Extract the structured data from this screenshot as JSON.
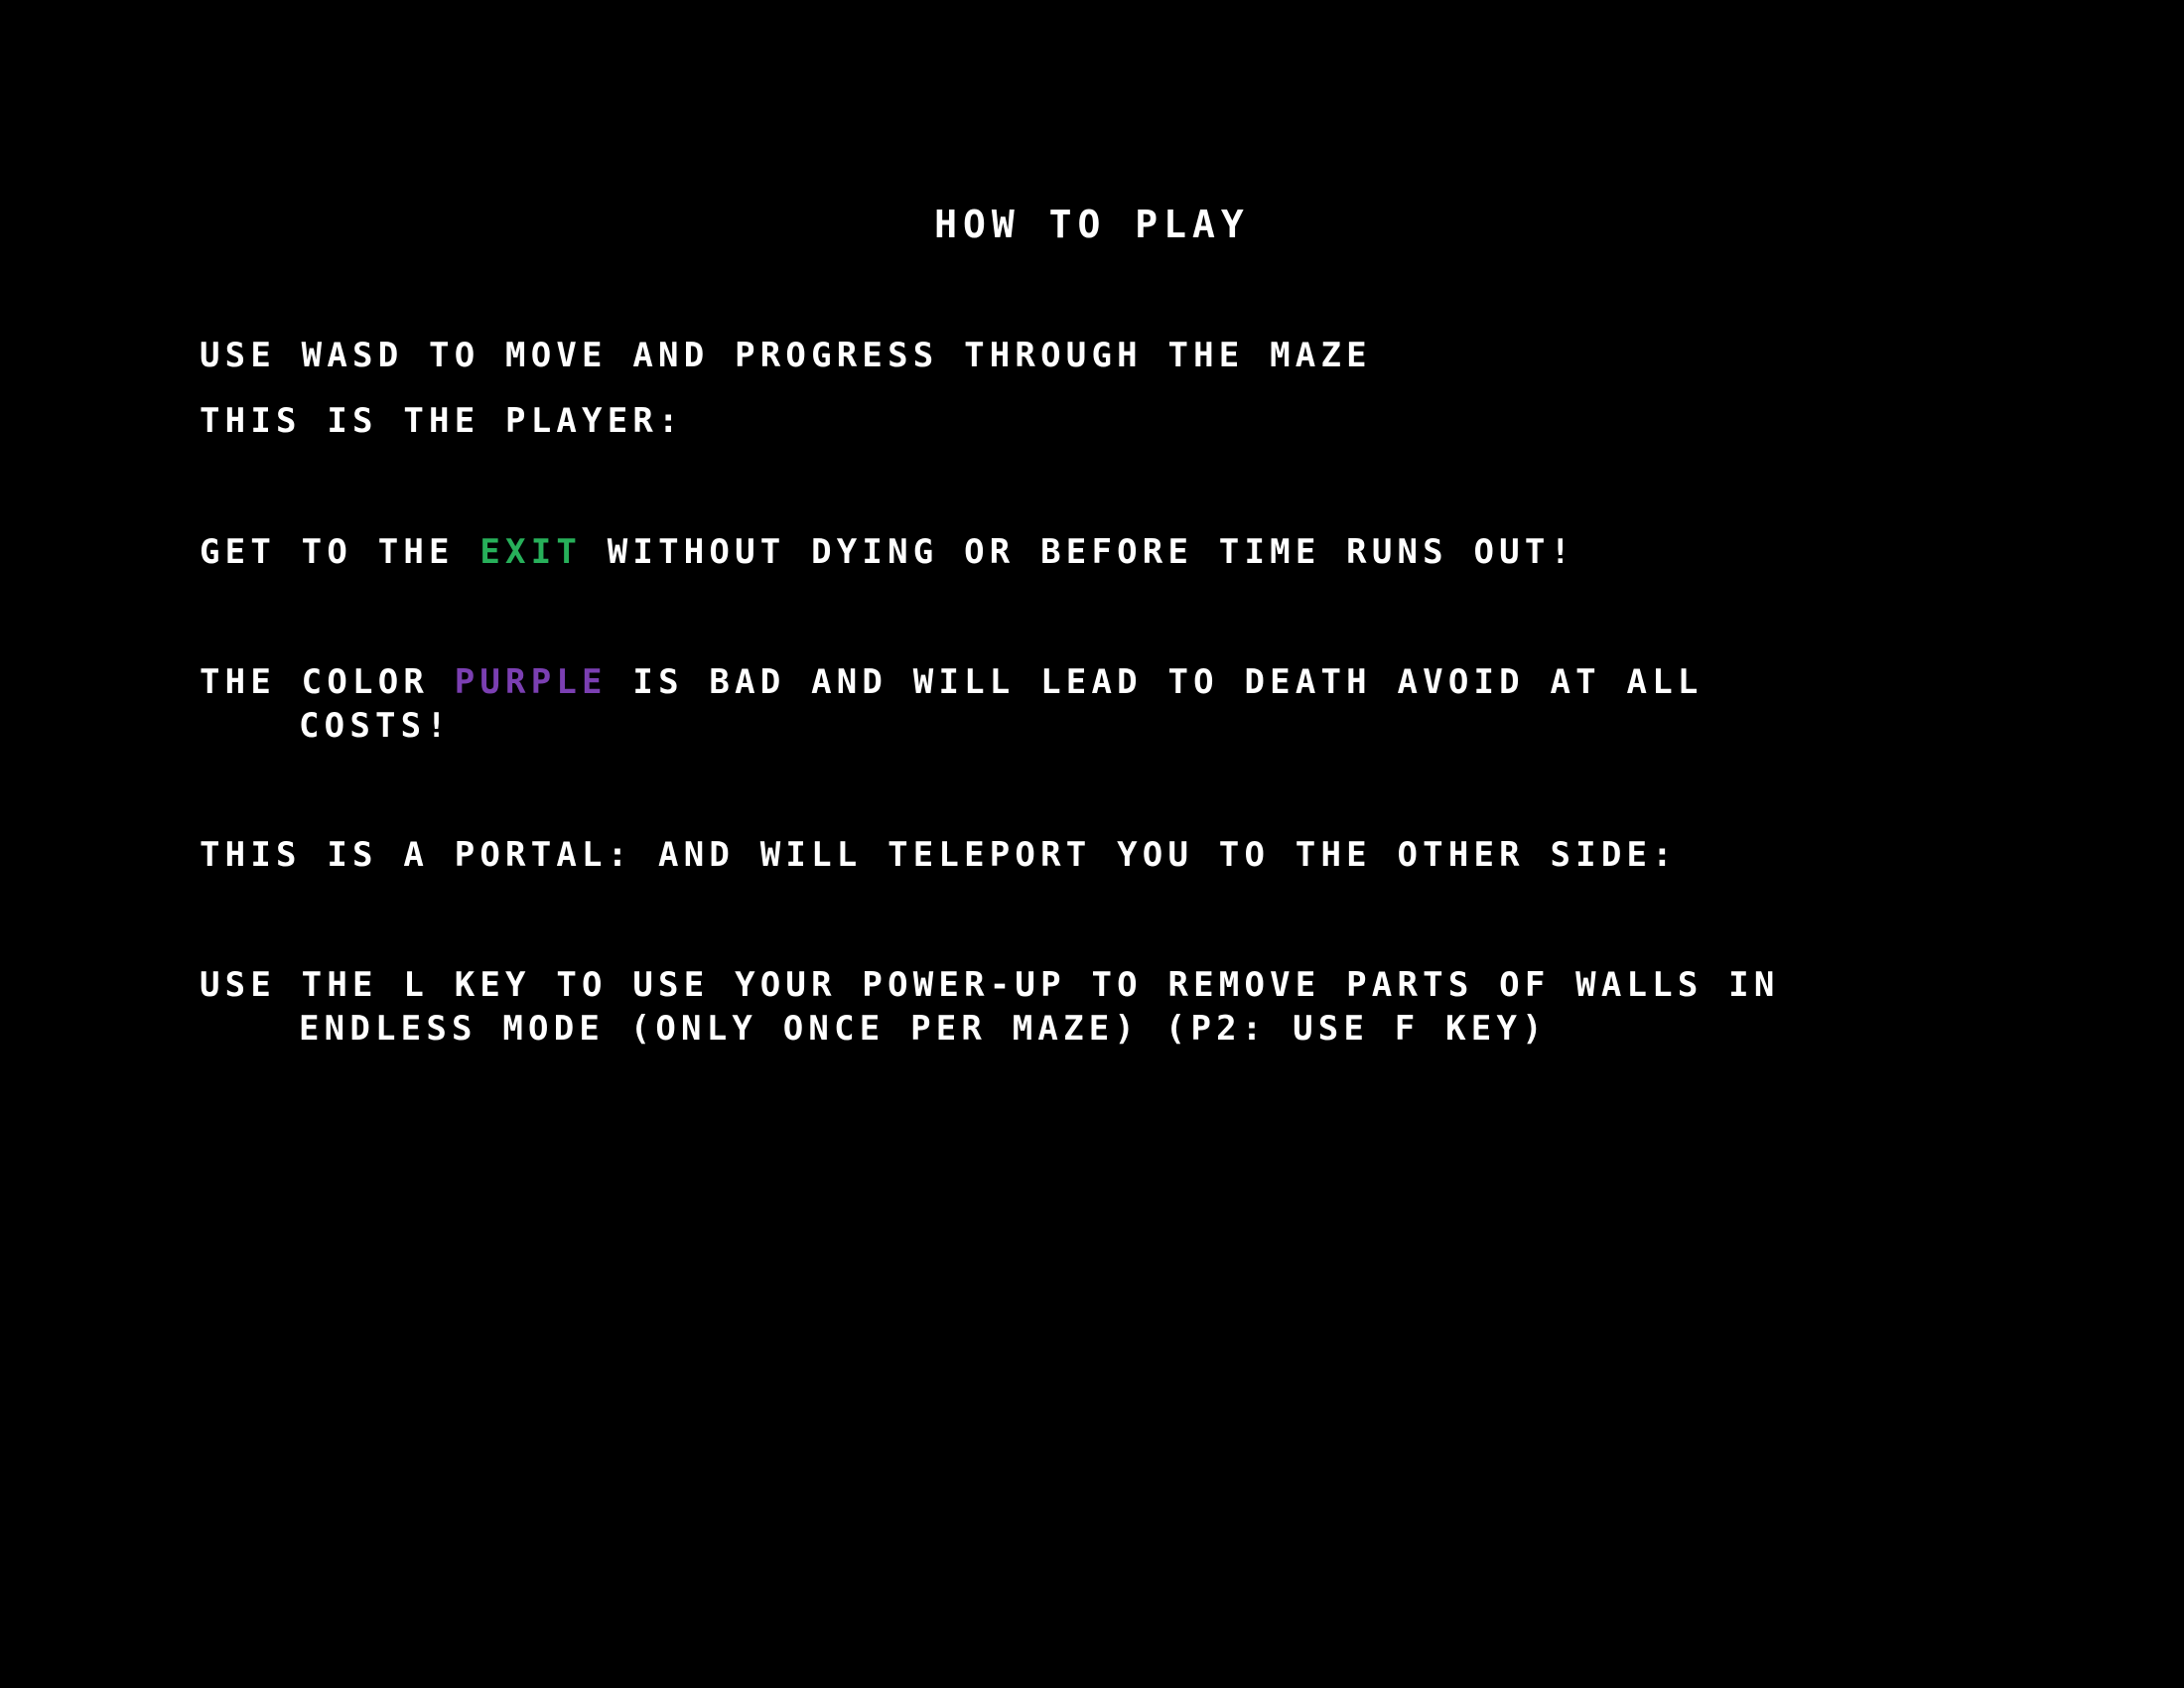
{
  "screen": {
    "title": "HOW TO PLAY",
    "lines": {
      "movement": "USE WASD TO MOVE AND PROGRESS THROUGH THE MAZE",
      "player": "THIS IS THE PLAYER:",
      "exit": {
        "before": "GET TO THE ",
        "highlight": "EXIT",
        "after": " WITHOUT DYING OR BEFORE TIME RUNS OUT!"
      },
      "purple": {
        "before": "THE COLOR ",
        "highlight": "PURPLE",
        "after": " IS BAD AND WILL LEAD TO DEATH AVOID AT ALL",
        "continuation": "COSTS!"
      },
      "portal": "THIS IS A PORTAL:  AND WILL TELEPORT YOU TO THE OTHER SIDE:",
      "powerup": {
        "first": "USE THE L KEY TO USE YOUR POWER-UP TO REMOVE PARTS OF WALLS IN",
        "continuation": "ENDLESS MODE (ONLY ONCE PER MAZE) (P2: USE F KEY)"
      }
    },
    "colors": {
      "background": "#000000",
      "text": "#ffffff",
      "exit_highlight": "#27b05a",
      "purple_highlight": "#7b3fb2"
    }
  }
}
